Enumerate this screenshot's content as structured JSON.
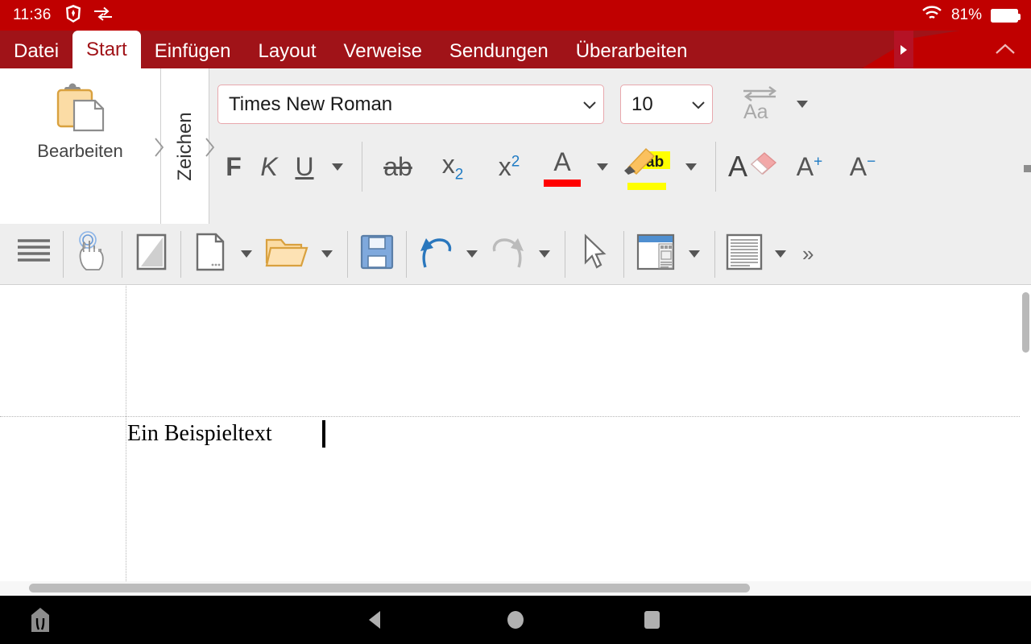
{
  "statusbar": {
    "time": "11:36",
    "brave_icon": "brave-shield-icon",
    "transfer_icon": "data-transfer-icon",
    "wifi_icon": "wifi-icon",
    "battery_percent": "81%",
    "battery_icon": "battery-icon",
    "background_color": "#c00000"
  },
  "ribbon_tabs": {
    "items": [
      {
        "label": "Datei",
        "active": false
      },
      {
        "label": "Start",
        "active": true
      },
      {
        "label": "Einfügen",
        "active": false
      },
      {
        "label": "Layout",
        "active": false
      },
      {
        "label": "Verweise",
        "active": false
      },
      {
        "label": "Sendungen",
        "active": false
      },
      {
        "label": "Überarbeiten",
        "active": false
      }
    ],
    "scroll_right_icon": "chevron-right-icon",
    "collapse_icon": "chevron-up-icon",
    "tabbar_color": "#a01318",
    "active_tab_text_color": "#a01318"
  },
  "ribbon": {
    "clipboard_group": {
      "icon": "clipboard-paste-icon",
      "label": "Bearbeiten"
    },
    "zeichen_group": {
      "label": "Zeichen",
      "chevron_left_icon": "chevron-left-icon",
      "chevron_right_icon": "chevron-right-icon"
    },
    "font_name": {
      "value": "Times New Roman",
      "dropdown_icon": "chevron-down-icon",
      "border_color": "#e8a8ad"
    },
    "font_size": {
      "value": "10",
      "dropdown_icon": "chevron-down-icon"
    },
    "change_case": {
      "label": "Aa",
      "icon": "change-case-icon",
      "dropdown_icon": "caret-down-icon",
      "disabled": true
    },
    "buttons": [
      {
        "label": "F",
        "name": "bold-button",
        "icon": "bold-icon"
      },
      {
        "label": "K",
        "name": "italic-button",
        "icon": "italic-icon"
      },
      {
        "label": "U",
        "name": "underline-button",
        "icon": "underline-icon"
      },
      {
        "label": "ab",
        "name": "strikethrough-button",
        "icon": "strikethrough-icon"
      },
      {
        "label": "x",
        "name": "subscript-button",
        "icon": "subscript-icon",
        "affix": "2"
      },
      {
        "label": "x",
        "name": "superscript-button",
        "icon": "superscript-icon",
        "affix": "2"
      },
      {
        "label": "A",
        "name": "font-color-button",
        "icon": "font-color-icon",
        "color": "#ff0000"
      },
      {
        "label": "ab",
        "name": "highlight-button",
        "icon": "text-highlight-icon",
        "color": "#ffff00"
      },
      {
        "label": "A",
        "name": "clear-formatting-button",
        "icon": "clear-formatting-icon"
      },
      {
        "label": "A",
        "name": "grow-font-button",
        "icon": "grow-font-icon",
        "affix": "+"
      },
      {
        "label": "A",
        "name": "shrink-font-button",
        "icon": "shrink-font-icon",
        "affix": "−"
      }
    ]
  },
  "quick_access": {
    "items": [
      {
        "name": "menu-lines-icon",
        "label": "menu-lines-icon"
      },
      {
        "name": "touch-mode-icon",
        "label": "touch-mode-icon"
      },
      {
        "name": "page-contrast-icon",
        "label": "page-contrast-icon"
      },
      {
        "name": "new-document-icon",
        "label": "new-document-icon"
      },
      {
        "name": "open-folder-icon",
        "label": "open-folder-icon"
      },
      {
        "name": "save-icon",
        "label": "save-icon"
      },
      {
        "name": "undo-icon",
        "label": "undo-icon"
      },
      {
        "name": "redo-icon",
        "label": "redo-icon"
      },
      {
        "name": "select-cursor-icon",
        "label": "select-cursor-icon"
      },
      {
        "name": "layout-view-icon",
        "label": "layout-view-icon"
      },
      {
        "name": "print-layout-icon",
        "label": "print-layout-icon"
      }
    ],
    "overflow_label": "»"
  },
  "document": {
    "text": "Ein Beispieltext",
    "cursor_visible": true,
    "font": "Times New Roman",
    "font_size": "10"
  },
  "navbar": {
    "home_icon": "home-icon",
    "back_icon": "back-triangle-icon",
    "circle_icon": "home-circle-icon",
    "recents_icon": "recents-square-icon"
  }
}
